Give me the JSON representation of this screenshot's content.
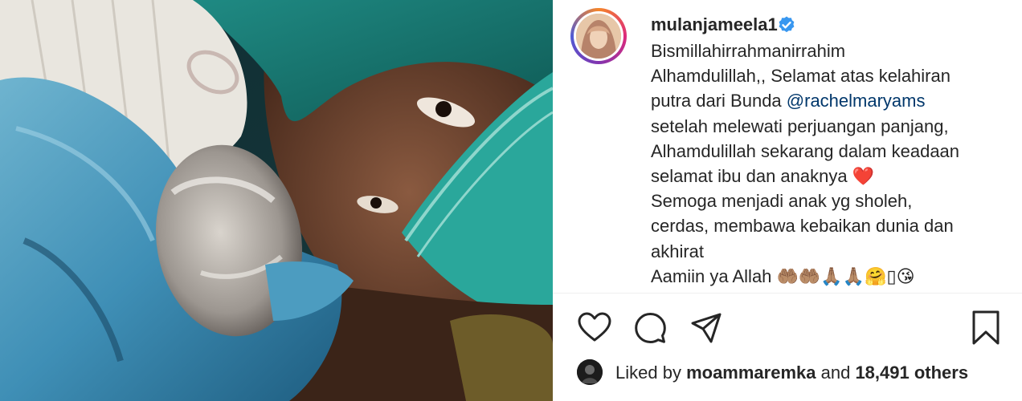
{
  "post": {
    "username": "mulanjameela1",
    "verified": true,
    "photo_description_icon": "newborn-photo",
    "caption": {
      "line1": "Bismillahirrahmanirrahim",
      "line2": "Alhamdulillah,, Selamat atas kelahiran",
      "line3_pre": "putra dari Bunda ",
      "line3_mention": "@rachelmaryams",
      "line4": "setelah melewati perjuangan panjang,",
      "line5": "Alhamdulillah sekarang dalam keadaan",
      "line6": "selamat ibu dan anaknya ❤️",
      "line7": "Semoga menjadi anak yg sholeh,",
      "line8": "cerdas, membawa kebaikan dunia dan",
      "line9": "akhirat",
      "line10": "Aamiin ya Allah 🤲🏽🤲🏽🙏🏽🙏🏽🤗▯😘"
    }
  },
  "actions": {
    "like_icon": "heart-icon",
    "comment_icon": "comment-icon",
    "share_icon": "share-icon",
    "save_icon": "bookmark-icon"
  },
  "likes": {
    "prefix": "Liked by ",
    "user": "moammaremka",
    "middle": " and ",
    "count": "18,491 others"
  },
  "colors": {
    "mention": "#00376b",
    "verified": "#3897f0",
    "text": "#262626"
  }
}
